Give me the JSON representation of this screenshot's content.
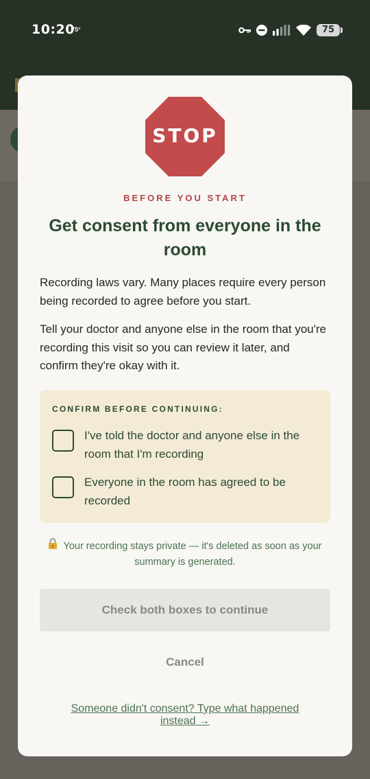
{
  "status_bar": {
    "time": "10:20",
    "temperature": "75°",
    "battery": "75"
  },
  "modal": {
    "stop_sign": "STOP",
    "eyebrow": "BEFORE YOU START",
    "title": "Get consent from everyone in the room",
    "paragraph_1": "Recording laws vary. Many places require every person being recorded to agree before you start.",
    "paragraph_2": "Tell your doctor and anyone else in the room that you're recording this visit so you can review it later, and confirm they're okay with it.",
    "confirm": {
      "heading": "CONFIRM BEFORE CONTINUING:",
      "items": [
        {
          "label": "I've told the doctor and anyone else in the room that I'm recording",
          "checked": false
        },
        {
          "label": "Everyone in the room has agreed to be recorded",
          "checked": false
        }
      ]
    },
    "privacy_note": "Your recording stays private — it's deleted as soon as your summary is generated.",
    "continue_button": "Check both boxes to continue",
    "cancel_button": "Cancel",
    "fallback_link": "Someone didn't consent? Type what happened instead →"
  },
  "colors": {
    "stop_red": "#c24b4b",
    "eyebrow_red": "#b04545",
    "brand_green": "#2b4a33",
    "confirm_bg": "#f4ebd6",
    "status_bar_bg": "#263226"
  },
  "icons": [
    "key-icon",
    "do-not-disturb-icon",
    "signal-icon",
    "wifi-icon",
    "battery-icon",
    "lock-icon"
  ]
}
